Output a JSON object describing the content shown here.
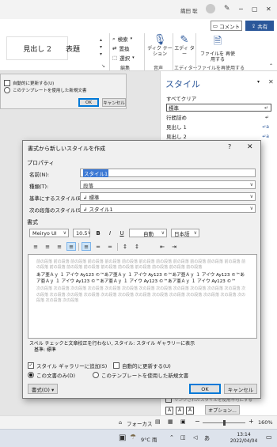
{
  "titlebar": {
    "user_name": "織田 聡",
    "pen_icon": "pen-icon"
  },
  "ribbon": {
    "comment_label": "コメント",
    "share_label": "共有",
    "styles": [
      "見出し 2",
      "表題"
    ],
    "find_label": "検索",
    "replace_label": "置換",
    "select_label": "選択",
    "edit_group": "編集",
    "dictation_label": "ディク テーション",
    "voice_group": "音声",
    "editor_label": "エディ ター",
    "editor_group": "エディター",
    "reuse_label": "ファイルを 再使用する",
    "reuse_group": "ファイルを再使用する"
  },
  "bg_dialog": {
    "opt1": "自動的に更新する(U)",
    "opt2": "このテンプレートを使用した新規文書",
    "ok": "OK",
    "cancel": "キャンセル"
  },
  "style_pane": {
    "title": "スタイル",
    "items": [
      {
        "label": "すべてクリア",
        "sym": ""
      },
      {
        "label": "標準",
        "sym": "↵"
      },
      {
        "label": "行間詰め",
        "sym": "↵"
      },
      {
        "label": "見出し 1",
        "sym": "↵a"
      },
      {
        "label": "見出し 2",
        "sym": "↵a"
      }
    ],
    "linked_label": "リンクされたスタイルを使用不可にする",
    "options_label": "オプション..."
  },
  "statusbar": {
    "focus_label": "フォーカス",
    "zoom": "160%"
  },
  "taskbar": {
    "weather": "9°C 雨",
    "time": "13:14",
    "date": "2022/04/04"
  },
  "dialog": {
    "title": "書式から新しいスタイルを作成",
    "help": "?",
    "properties_section": "プロパティ",
    "name_label": "名前(N):",
    "name_value": "スタイル1",
    "type_label": "種類(T):",
    "type_value": "段落",
    "base_label": "基準にするスタイル(B):",
    "base_value": "↲ 標準",
    "next_label": "次の段落のスタイル(S):",
    "next_value": "↲ スタイル1",
    "format_section": "書式",
    "font": "Meiryo UI",
    "size": "10.5",
    "bold": "B",
    "italic": "I",
    "underline": "U",
    "color": "自動",
    "lang": "日本語",
    "preview_prev": "前の段落 前の段落 前の段落 前の段落 前の段落 前の段落 前の段落 前の段落 前の段落 前の段落 前の段落 前の段落 前の段落 前の段落 前の段落 前の段落 前の段落 前の段落 前の段落 前の段落 前の段落 前の段落",
    "preview_sample": "あア亜Ａｙ １ アイウ Ay123 ©™あア亜Ａｙ １ アイウ Ay123 ©™あア亜Ａｙ １ アイウ Ay123 ©™あア亜Ａｙ １ アイウ Ay123 ©™あア亜Ａｙ １ アイウ Ay123 ©™あア亜Ａｙ １ アイウ Ay123 ©™",
    "preview_next": "次の段落 次の段落 次の段落 次の段落 次の段落 次の段落 次の段落 次の段落 次の段落 次の段落 次の段落 次の段落 次の段落 次の段落 次の段落 次の段落 次の段落 次の段落 次の段落 次の段落 次の段落 次の段落 次の段落 次の段落 次の段落 次の段落 次の段落",
    "desc1": "スペル チェックと文章校正を行わない, スタイル: スタイル ギャラリーに表示",
    "desc2": "基準: 標準",
    "add_gallery": "スタイル ギャラリーに追加(S)",
    "auto_update": "自動的に更新する(U)",
    "only_doc": "この文書のみ(D)",
    "new_template": "このテンプレートを使用した新規文書",
    "format_btn": "書式(O) ▾",
    "ok": "OK",
    "cancel": "キャンセル"
  }
}
